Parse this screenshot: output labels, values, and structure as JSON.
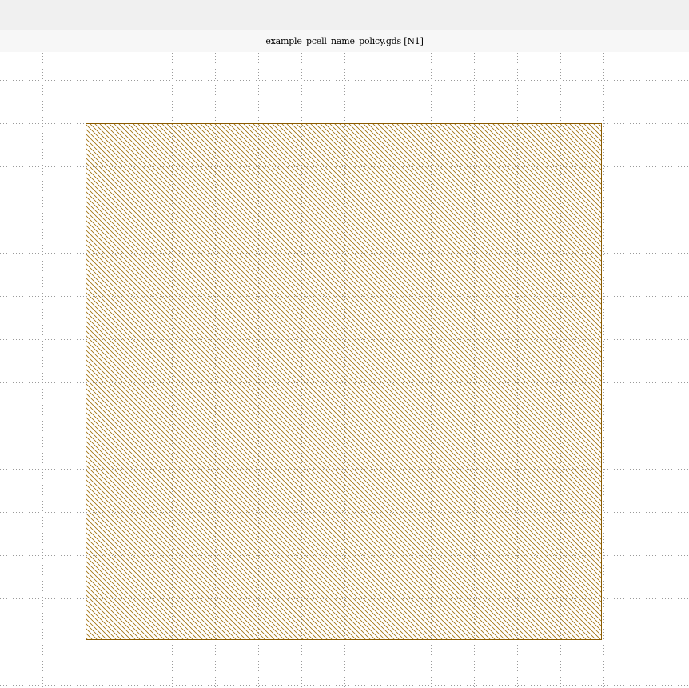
{
  "window": {
    "title": "example_pcell_name_policy.gds [N1]"
  },
  "colors": {
    "toolbar_bg": "#f0f0f0",
    "title_bg": "#f7f7f7",
    "canvas_bg": "#ffffff",
    "grid_dot": "#9a9a9a",
    "shape_stroke": "#8a5a00",
    "shape_hatch": "#a0700c"
  },
  "layout_view": {
    "grid": true,
    "shape_fill_pattern": "diagonal-hatch"
  }
}
